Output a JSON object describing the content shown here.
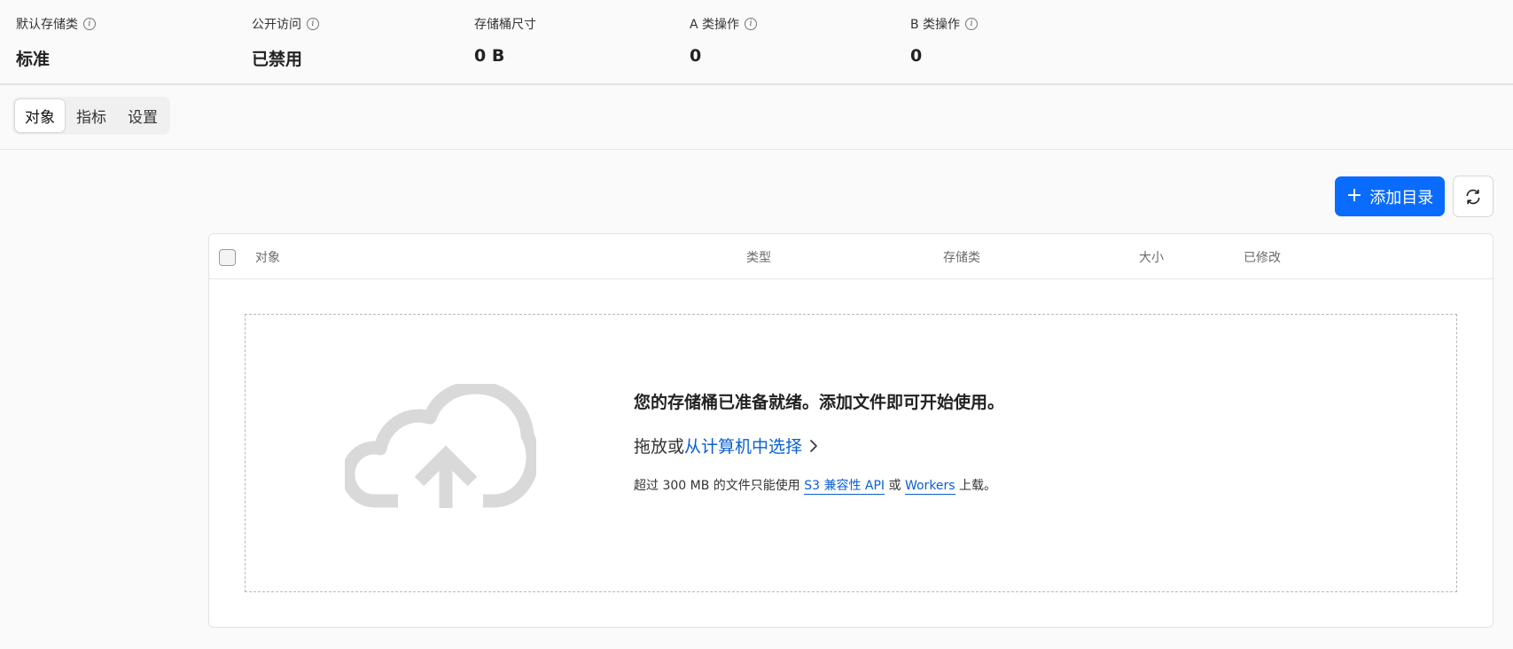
{
  "stats": [
    {
      "label": "默认存储类",
      "value": "标准",
      "has_info": true
    },
    {
      "label": "公开访问",
      "value": "已禁用",
      "has_info": true
    },
    {
      "label": "存储桶尺寸",
      "value": "0 B",
      "has_info": false
    },
    {
      "label": "A 类操作",
      "value": "0",
      "has_info": true
    },
    {
      "label": "B 类操作",
      "value": "0",
      "has_info": true
    }
  ],
  "info_glyph": "i",
  "tabs": [
    {
      "label": "对象",
      "active": true
    },
    {
      "label": "指标",
      "active": false
    },
    {
      "label": "设置",
      "active": false
    }
  ],
  "toolbar": {
    "add_plus": "+",
    "add_label": "添加目录",
    "refresh_icon": "refresh-icon"
  },
  "table": {
    "columns": [
      "对象",
      "类型",
      "存储类",
      "大小",
      "已修改"
    ]
  },
  "dropzone": {
    "icon": "cloud-upload-icon",
    "title": "您的存储桶已准备就绪。添加文件即可开始使用。",
    "drag_prefix": "拖放或",
    "select_link": "从计算机中选择",
    "note_prefix": "超过 300 MB 的文件只能使用 ",
    "s3_link": "S3 兼容性 API",
    "note_or": " 或 ",
    "workers_link": "Workers",
    "note_suffix": " 上载。"
  },
  "colors": {
    "accent": "#0a6cff",
    "link": "#0a5fd6",
    "cloud": "#d9d9d9"
  }
}
